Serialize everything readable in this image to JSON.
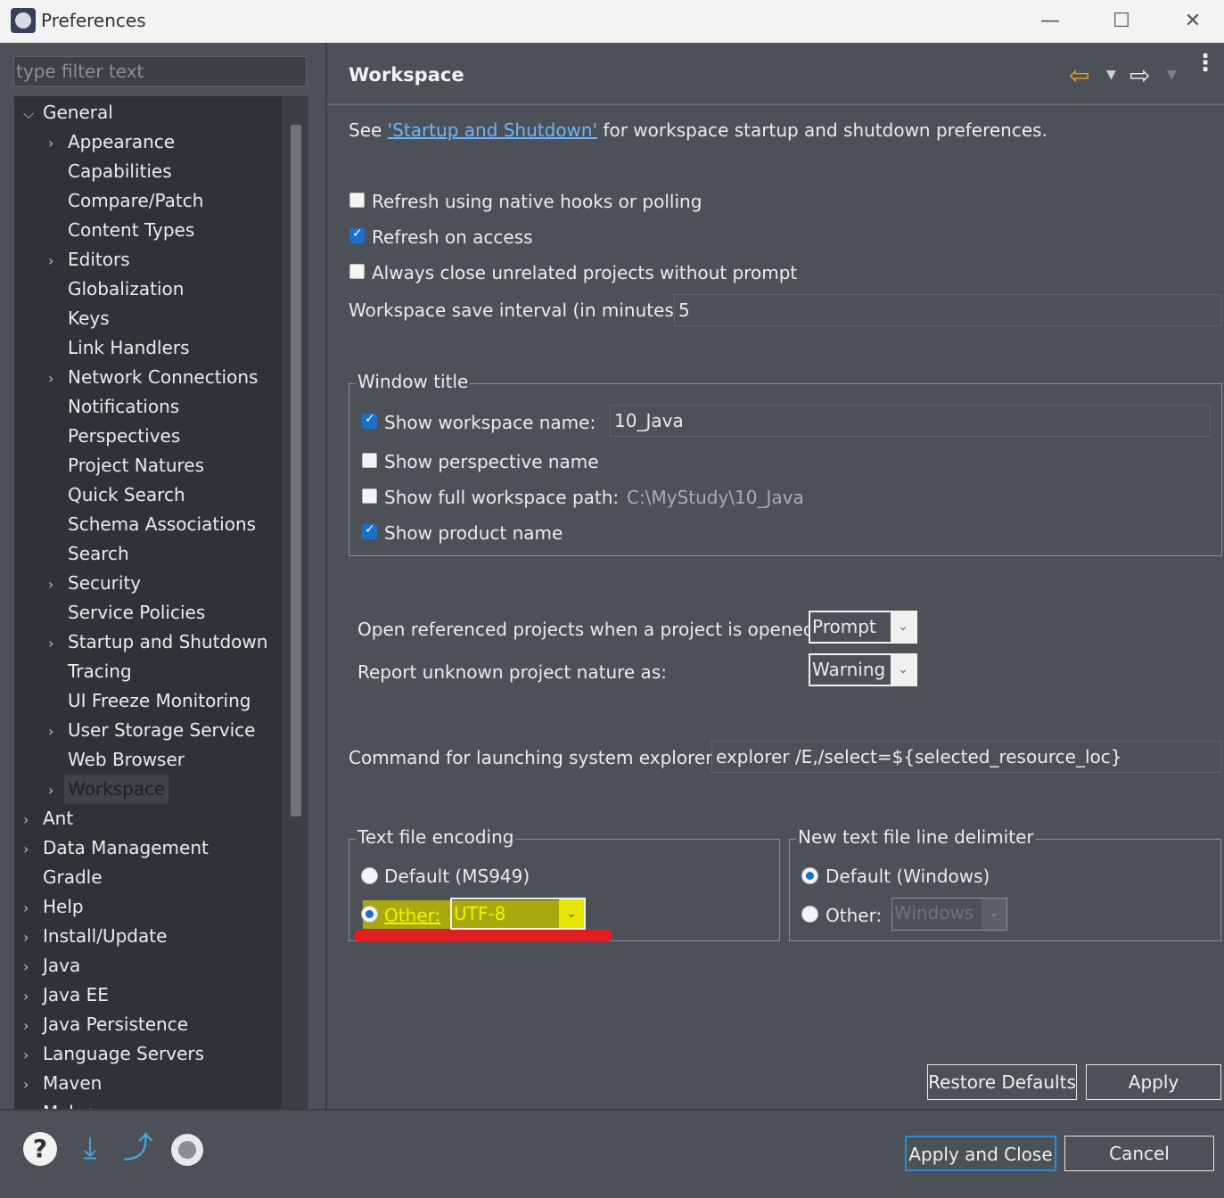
{
  "window": {
    "title": "Preferences"
  },
  "filter": {
    "placeholder": "type filter text"
  },
  "tree": {
    "items": [
      {
        "label": "General",
        "level": 0,
        "expand": "open"
      },
      {
        "label": "Appearance",
        "level": 1,
        "expand": "closed"
      },
      {
        "label": "Capabilities",
        "level": 1,
        "expand": ""
      },
      {
        "label": "Compare/Patch",
        "level": 1,
        "expand": ""
      },
      {
        "label": "Content Types",
        "level": 1,
        "expand": ""
      },
      {
        "label": "Editors",
        "level": 1,
        "expand": "closed"
      },
      {
        "label": "Globalization",
        "level": 1,
        "expand": ""
      },
      {
        "label": "Keys",
        "level": 1,
        "expand": ""
      },
      {
        "label": "Link Handlers",
        "level": 1,
        "expand": ""
      },
      {
        "label": "Network Connections",
        "level": 1,
        "expand": "closed"
      },
      {
        "label": "Notifications",
        "level": 1,
        "expand": ""
      },
      {
        "label": "Perspectives",
        "level": 1,
        "expand": ""
      },
      {
        "label": "Project Natures",
        "level": 1,
        "expand": ""
      },
      {
        "label": "Quick Search",
        "level": 1,
        "expand": ""
      },
      {
        "label": "Schema Associations",
        "level": 1,
        "expand": ""
      },
      {
        "label": "Search",
        "level": 1,
        "expand": ""
      },
      {
        "label": "Security",
        "level": 1,
        "expand": "closed"
      },
      {
        "label": "Service Policies",
        "level": 1,
        "expand": ""
      },
      {
        "label": "Startup and Shutdown",
        "level": 1,
        "expand": "closed"
      },
      {
        "label": "Tracing",
        "level": 1,
        "expand": ""
      },
      {
        "label": "UI Freeze Monitoring",
        "level": 1,
        "expand": ""
      },
      {
        "label": "User Storage Service",
        "level": 1,
        "expand": "closed"
      },
      {
        "label": "Web Browser",
        "level": 1,
        "expand": ""
      },
      {
        "label": "Workspace",
        "level": 1,
        "expand": "closed",
        "selected": true
      },
      {
        "label": "Ant",
        "level": 0,
        "expand": "closed"
      },
      {
        "label": "Data Management",
        "level": 0,
        "expand": "closed"
      },
      {
        "label": "Gradle",
        "level": 0,
        "expand": ""
      },
      {
        "label": "Help",
        "level": 0,
        "expand": "closed"
      },
      {
        "label": "Install/Update",
        "level": 0,
        "expand": "closed"
      },
      {
        "label": "Java",
        "level": 0,
        "expand": "closed"
      },
      {
        "label": "Java EE",
        "level": 0,
        "expand": "closed"
      },
      {
        "label": "Java Persistence",
        "level": 0,
        "expand": "closed"
      },
      {
        "label": "Language Servers",
        "level": 0,
        "expand": "closed"
      },
      {
        "label": "Maven",
        "level": 0,
        "expand": "closed"
      },
      {
        "label": "Mylyn",
        "level": 0,
        "expand": "closed"
      }
    ]
  },
  "page": {
    "title": "Workspace",
    "see_prefix": "See ",
    "see_link": "'Startup and Shutdown'",
    "see_suffix": " for workspace startup and shutdown preferences.",
    "refresh_native": {
      "label": "Refresh using native hooks or polling",
      "checked": false
    },
    "refresh_access": {
      "label": "Refresh on access",
      "checked": true
    },
    "always_close": {
      "label": "Always close unrelated projects without prompt",
      "checked": false
    },
    "save_interval": {
      "label": "Workspace save interval (in minutes):",
      "value": "5"
    },
    "window_title": {
      "group": "Window title",
      "show_ws_name": {
        "label": "Show workspace name:",
        "checked": true,
        "value": "10_Java"
      },
      "show_perspective": {
        "label": "Show perspective name",
        "checked": false
      },
      "show_full_path": {
        "label": "Show full workspace path:",
        "checked": false,
        "value": "C:\\MyStudy\\10_Java"
      },
      "show_product": {
        "label": "Show product name",
        "checked": true
      }
    },
    "open_ref": {
      "label": "Open referenced projects when a project is opened:",
      "value": "Prompt"
    },
    "unknown_nature": {
      "label": "Report unknown project nature as:",
      "value": "Warning"
    },
    "explorer": {
      "label": "Command for launching system explorer:",
      "value": "explorer /E,/select=${selected_resource_loc}"
    },
    "encoding": {
      "group": "Text file encoding",
      "default_label": "Default (MS949)",
      "other_label": "Other:",
      "other_value": "UTF-8",
      "selected": "other",
      "highlight_color": "#e6e600",
      "underline_color": "#e02020"
    },
    "delimiter": {
      "group": "New text file line delimiter",
      "default_label": "Default (Windows)",
      "other_label": "Other:",
      "other_value": "Windows",
      "selected": "default"
    },
    "restore_defaults": "Restore Defaults",
    "apply": "Apply"
  },
  "footer": {
    "apply_close": "Apply and Close",
    "cancel": "Cancel",
    "icons": [
      "help-icon",
      "import-icon",
      "export-icon",
      "record-icon"
    ]
  }
}
